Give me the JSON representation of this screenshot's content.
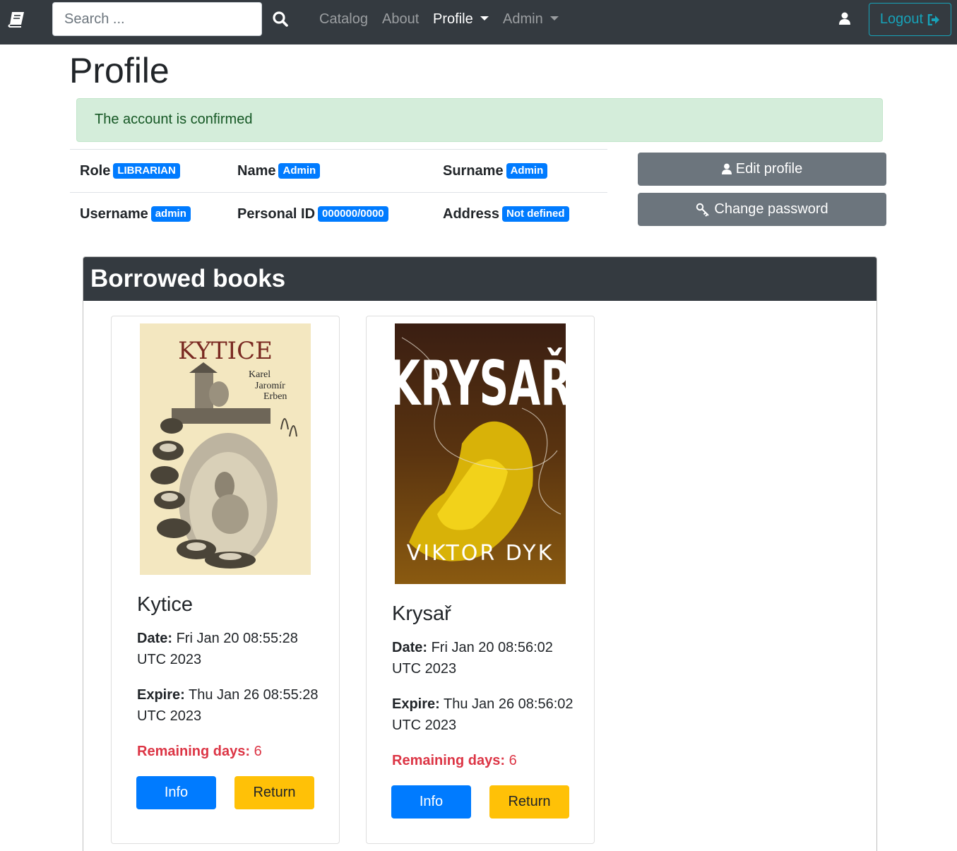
{
  "navbar": {
    "brand_icon": "book-icon",
    "search_placeholder": "Search ...",
    "links": [
      "Catalog",
      "About"
    ],
    "profile_label": "Profile",
    "admin_label": "Admin",
    "logout_label": "Logout",
    "accent_color": "#17a2b8"
  },
  "page": {
    "title": "Profile",
    "alert": "The account is confirmed"
  },
  "profile": {
    "role_label": "Role",
    "role_value": "LIBRARIAN",
    "name_label": "Name",
    "name_value": "Admin",
    "surname_label": "Surname",
    "surname_value": "Admin",
    "username_label": "Username",
    "username_value": "admin",
    "personal_id_label": "Personal ID",
    "personal_id_value": "000000/0000",
    "address_label": "Address",
    "address_value": "Not defined",
    "edit_label": "Edit profile",
    "change_password_label": "Change password"
  },
  "borrowed": {
    "title": "Borrowed books",
    "books": [
      {
        "title": "Kytice",
        "cover_title": "KYTICE",
        "cover_author": [
          "Karel",
          "Jaromír",
          "Erben"
        ],
        "date_label": "Date:",
        "date_value": "Fri Jan 20 08:55:28 UTC 2023",
        "expire_label": "Expire:",
        "expire_value": "Thu Jan 26 08:55:28 UTC 2023",
        "remaining_label": "Remaining days:",
        "remaining_value": "6",
        "info_label": "Info",
        "return_label": "Return"
      },
      {
        "title": "Krysař",
        "cover_title": "KRYSAŘ",
        "cover_author": "VIKTOR DYK",
        "date_label": "Date:",
        "date_value": "Fri Jan 20 08:56:02 UTC 2023",
        "expire_label": "Expire:",
        "expire_value": "Thu Jan 26 08:56:02 UTC 2023",
        "remaining_label": "Remaining days:",
        "remaining_value": "6",
        "info_label": "Info",
        "return_label": "Return"
      }
    ]
  }
}
